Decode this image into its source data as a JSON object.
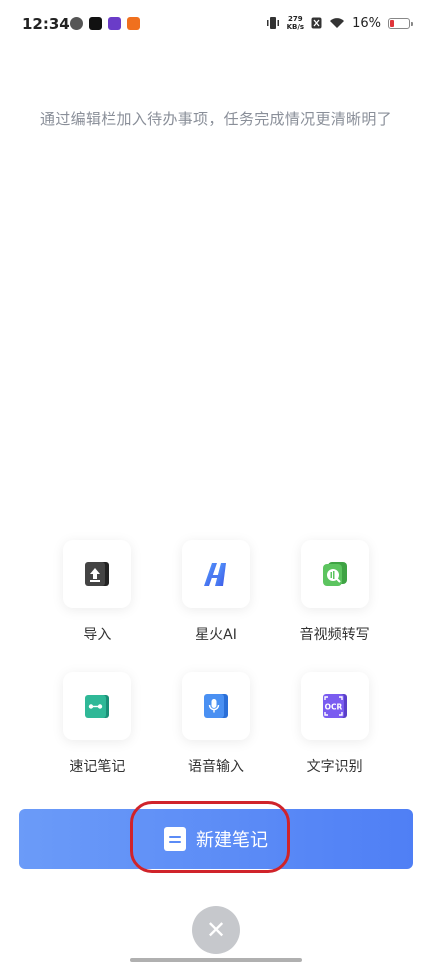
{
  "status_bar": {
    "time": "12:34",
    "net_speed_value": "279",
    "net_speed_unit": "KB/s",
    "battery": "16%"
  },
  "hint_text": "通过编辑栏加入待办事项，任务完成情况更清晰明了",
  "tools": [
    {
      "label": "导入",
      "icon": "import-icon"
    },
    {
      "label": "星火AI",
      "icon": "spark-ai-icon"
    },
    {
      "label": "音视频转写",
      "icon": "av-transcribe-icon"
    },
    {
      "label": "速记笔记",
      "icon": "shorthand-icon"
    },
    {
      "label": "语音输入",
      "icon": "microphone-icon"
    },
    {
      "label": "文字识别",
      "icon": "ocr-icon"
    }
  ],
  "ocr_icon_text": "OCR",
  "new_note_label": "新建笔记",
  "close_glyph": "✕",
  "colors": {
    "accent": "#5b8bf6",
    "highlight": "#d0232a"
  }
}
